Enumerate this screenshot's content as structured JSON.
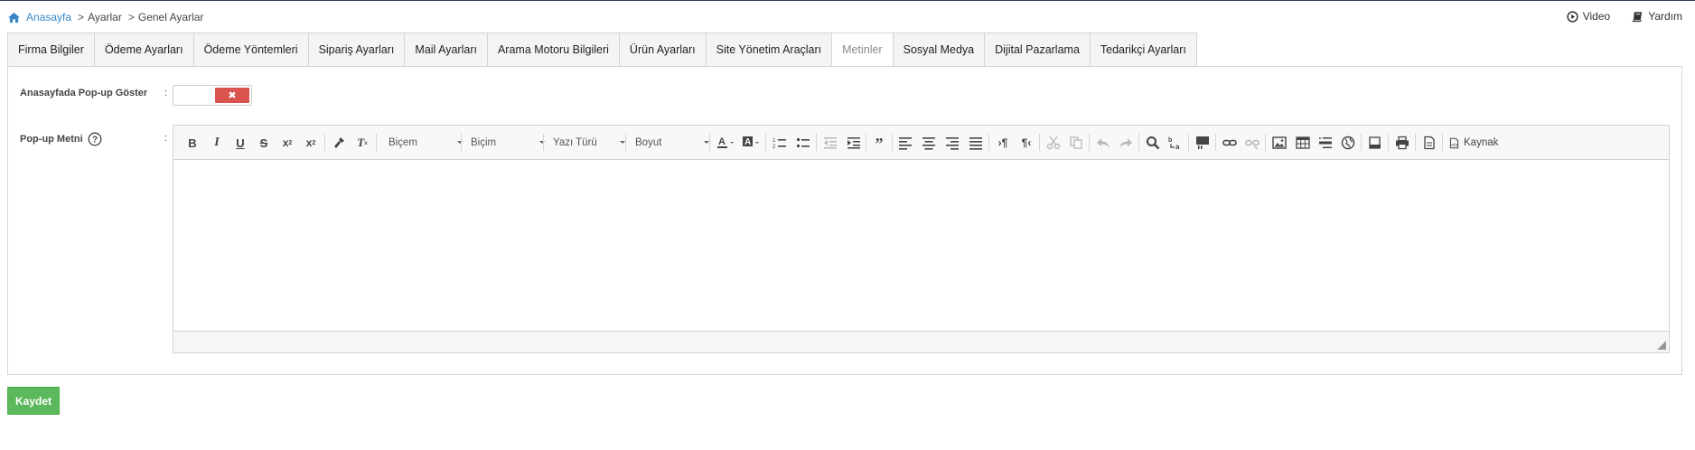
{
  "breadcrumb": {
    "home": "Anasayfa",
    "items": [
      "Ayarlar",
      "Genel Ayarlar"
    ],
    "separator": ">"
  },
  "top_links": {
    "video": "Video",
    "help": "Yardım"
  },
  "tabs": [
    {
      "label": "Firma Bilgiler",
      "active": false
    },
    {
      "label": "Ödeme Ayarları",
      "active": false
    },
    {
      "label": "Ödeme Yöntemleri",
      "active": false
    },
    {
      "label": "Sipariş Ayarları",
      "active": false
    },
    {
      "label": "Mail Ayarları",
      "active": false
    },
    {
      "label": "Arama Motoru Bilgileri",
      "active": false
    },
    {
      "label": "Ürün Ayarları",
      "active": false
    },
    {
      "label": "Site Yönetim Araçları",
      "active": false
    },
    {
      "label": "Metinler",
      "active": true
    },
    {
      "label": "Sosyal Medya",
      "active": false
    },
    {
      "label": "Dijital Pazarlama",
      "active": false
    },
    {
      "label": "Tedarikçi Ayarları",
      "active": false
    }
  ],
  "form": {
    "popup_show_label": "Anasayfada Pop-up Göster",
    "popup_text_label": "Pop-up Metni",
    "colon": ":",
    "toggle_state": "off",
    "toggle_off_symbol": "✖"
  },
  "editor": {
    "combos": {
      "style": "Biçem",
      "format": "Biçim",
      "font": "Yazı Türü",
      "size": "Boyut"
    },
    "source_label": "Kaynak",
    "content": ""
  },
  "buttons": {
    "save": "Kaydet"
  },
  "colors": {
    "link": "#3a87c8",
    "toggle_off": "#d9534f",
    "save": "#5cb85c"
  }
}
